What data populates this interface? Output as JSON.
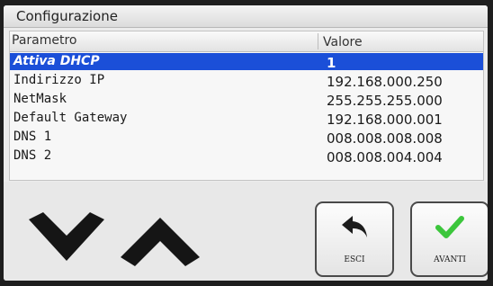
{
  "window": {
    "title": "Configurazione"
  },
  "table": {
    "headers": {
      "parameter": "Parametro",
      "value": "Valore"
    },
    "rows": [
      {
        "parameter": "Attiva DHCP",
        "value": "1",
        "selected": true
      },
      {
        "parameter": "Indirizzo IP",
        "value": "192.168.000.250"
      },
      {
        "parameter": "NetMask",
        "value": "255.255.255.000"
      },
      {
        "parameter": "Default Gateway",
        "value": "192.168.000.001"
      },
      {
        "parameter": "DNS 1",
        "value": "008.008.008.008"
      },
      {
        "parameter": "DNS 2",
        "value": "008.008.004.004"
      }
    ]
  },
  "buttons": {
    "back": {
      "label": "ESCI",
      "icon": "back-arrow-icon"
    },
    "next": {
      "label": "AVANTI",
      "icon": "checkmark-icon"
    }
  },
  "navigation": {
    "down_icon": "chevron-down-icon",
    "up_icon": "chevron-up-icon"
  },
  "colors": {
    "selection": "#1b4fd8",
    "check": "#3cc63c"
  }
}
